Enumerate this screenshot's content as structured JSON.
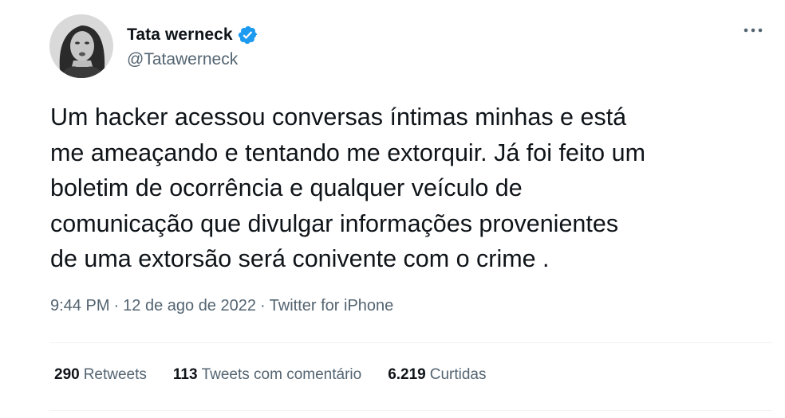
{
  "author": {
    "display_name": "Tata werneck",
    "handle": "@Tatawerneck",
    "verified": true,
    "verified_icon": "verified-badge-icon",
    "badge_color": "#1d9bf0"
  },
  "menu_icon": "more-options-icon",
  "tweet": {
    "text": "Um hacker acessou conversas íntimas minhas e está\nme ameaçando e tentando me extorquir. Já foi feito um\nboletim de ocorrência e qualquer veículo de\ncomunicação que divulgar informações provenientes\nde uma extorsão será conivente com o crime ."
  },
  "meta": {
    "time": "9:44 PM",
    "separator": "·",
    "date": "12 de ago de 2022",
    "source": "Twitter for iPhone"
  },
  "stats": {
    "retweets_count": "290",
    "retweets_label": "Retweets",
    "quotes_count": "113",
    "quotes_label": "Tweets com comentário",
    "likes_count": "6.219",
    "likes_label": "Curtidas"
  }
}
